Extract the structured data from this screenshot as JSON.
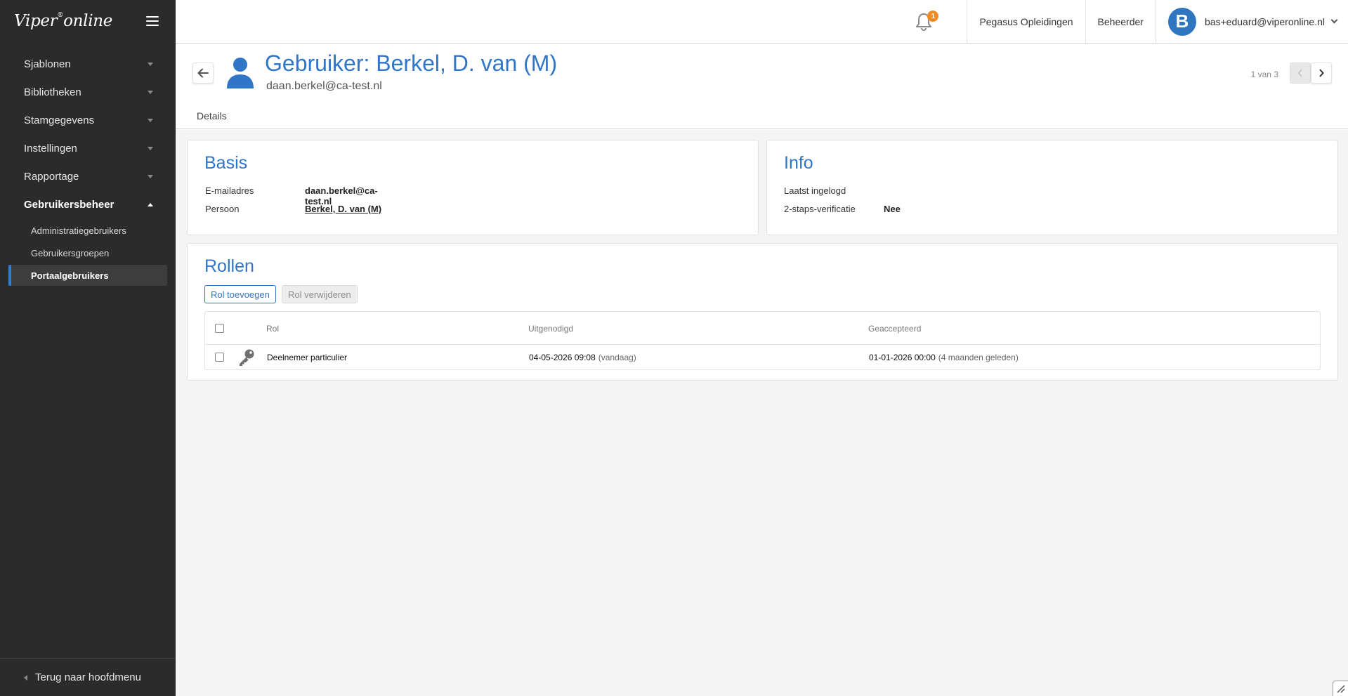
{
  "app": {
    "logo_text": "Viper",
    "logo_mark": "®",
    "logo_suffix": "online"
  },
  "sidebar": {
    "items": [
      {
        "label": "Sjablonen"
      },
      {
        "label": "Bibliotheken"
      },
      {
        "label": "Stamgegevens"
      },
      {
        "label": "Instellingen"
      },
      {
        "label": "Rapportage"
      },
      {
        "label": "Gebruikersbeheer"
      }
    ],
    "subitems": [
      {
        "label": "Administratiegebruikers"
      },
      {
        "label": "Gebruikersgroepen"
      },
      {
        "label": "Portaalgebruikers"
      }
    ],
    "footer_label": "Terug naar hoofdmenu"
  },
  "topbar": {
    "notification_count": "1",
    "organisation": "Pegasus Opleidingen",
    "role": "Beheerder",
    "avatar_initial": "B",
    "user_email": "bas+eduard@viperonline.nl"
  },
  "header": {
    "title": "Gebruiker: Berkel, D. van (M)",
    "subtitle": "daan.berkel@ca-test.nl",
    "pager": "1 van 3",
    "tab": "Details"
  },
  "basis": {
    "title": "Basis",
    "email_label": "E-mailadres",
    "email_value": "daan.berkel@ca-test.nl",
    "person_label": "Persoon",
    "person_value": "Berkel, D. van (M)"
  },
  "info": {
    "title": "Info",
    "last_login_label": "Laatst ingelogd",
    "twofa_label": "2-staps-verificatie",
    "twofa_value": "Nee"
  },
  "rollen": {
    "title": "Rollen",
    "add_button": "Rol toevoegen",
    "remove_button": "Rol verwijderen",
    "columns": {
      "rol": "Rol",
      "uitgenodigd": "Uitgenodigd",
      "geaccepteerd": "Geaccepteerd"
    },
    "rows": [
      {
        "rol": "Deelnemer particulier",
        "uitgenodigd": "04-05-2026 09:08",
        "uitgenodigd_rel": "(vandaag)",
        "geaccepteerd": "01-01-2026 00:00",
        "geaccepteerd_rel": "(4 maanden geleden)"
      }
    ]
  },
  "colors": {
    "accent": "#2f75c8",
    "sidebar_bg": "#2b2b2b",
    "badge": "#f08a24"
  }
}
